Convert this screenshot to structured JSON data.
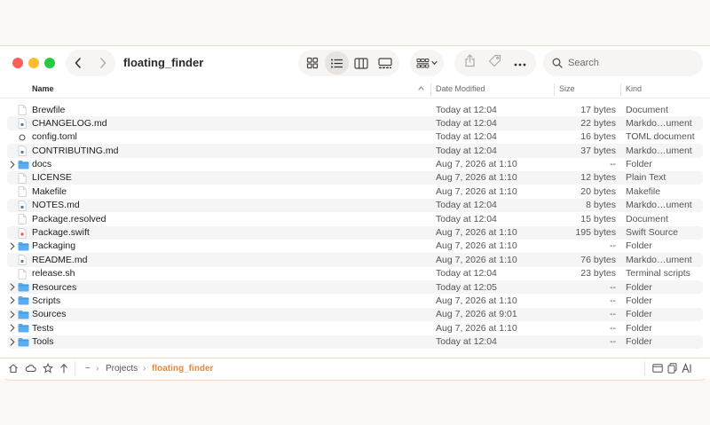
{
  "window": {
    "title": "floating_finder",
    "search_placeholder": "Search"
  },
  "columns": {
    "name": "Name",
    "date": "Date Modified",
    "size": "Size",
    "kind": "Kind"
  },
  "files": [
    {
      "name": "Brewfile",
      "date": "Today at 12:04",
      "size": "17 bytes",
      "kind": "Document",
      "icon": "doc-icon",
      "folder": false
    },
    {
      "name": "CHANGELOG.md",
      "date": "Today at 12:04",
      "size": "22 bytes",
      "kind": "Markdo…ument",
      "icon": "markdown-icon",
      "folder": false
    },
    {
      "name": "config.toml",
      "date": "Today at 12:04",
      "size": "16 bytes",
      "kind": "TOML document",
      "icon": "toml-icon",
      "folder": false
    },
    {
      "name": "CONTRIBUTING.md",
      "date": "Today at 12:04",
      "size": "37 bytes",
      "kind": "Markdo…ument",
      "icon": "markdown-icon",
      "folder": false
    },
    {
      "name": "docs",
      "date": "Aug 7, 2026 at 1:10",
      "size": "--",
      "kind": "Folder",
      "icon": "folder-icon",
      "folder": true
    },
    {
      "name": "LICENSE",
      "date": "Aug 7, 2026 at 1:10",
      "size": "12 bytes",
      "kind": "Plain Text",
      "icon": "doc-icon",
      "folder": false
    },
    {
      "name": "Makefile",
      "date": "Aug 7, 2026 at 1:10",
      "size": "20 bytes",
      "kind": "Makefile",
      "icon": "doc-icon",
      "folder": false
    },
    {
      "name": "NOTES.md",
      "date": "Today at 12:04",
      "size": "8 bytes",
      "kind": "Markdo…ument",
      "icon": "markdown-icon",
      "folder": false
    },
    {
      "name": "Package.resolved",
      "date": "Today at 12:04",
      "size": "15 bytes",
      "kind": "Document",
      "icon": "doc-icon",
      "folder": false
    },
    {
      "name": "Package.swift",
      "date": "Aug 7, 2026 at 1:10",
      "size": "195 bytes",
      "kind": "Swift Source",
      "icon": "swift-icon",
      "folder": false
    },
    {
      "name": "Packaging",
      "date": "Aug 7, 2026 at 1:10",
      "size": "--",
      "kind": "Folder",
      "icon": "folder-icon",
      "folder": true
    },
    {
      "name": "README.md",
      "date": "Aug 7, 2026 at 1:10",
      "size": "76 bytes",
      "kind": "Markdo…ument",
      "icon": "markdown-icon",
      "folder": false
    },
    {
      "name": "release.sh",
      "date": "Today at 12:04",
      "size": "23 bytes",
      "kind": "Terminal scripts",
      "icon": "doc-icon",
      "folder": false
    },
    {
      "name": "Resources",
      "date": "Today at 12:05",
      "size": "--",
      "kind": "Folder",
      "icon": "folder-icon",
      "folder": true
    },
    {
      "name": "Scripts",
      "date": "Aug 7, 2026 at 1:10",
      "size": "--",
      "kind": "Folder",
      "icon": "folder-icon",
      "folder": true
    },
    {
      "name": "Sources",
      "date": "Aug 7, 2026 at 9:01",
      "size": "--",
      "kind": "Folder",
      "icon": "folder-icon",
      "folder": true
    },
    {
      "name": "Tests",
      "date": "Aug 7, 2026 at 1:10",
      "size": "--",
      "kind": "Folder",
      "icon": "folder-icon",
      "folder": true
    },
    {
      "name": "Tools",
      "date": "Today at 12:04",
      "size": "--",
      "kind": "Folder",
      "icon": "folder-icon",
      "folder": true
    }
  ],
  "pathbar": {
    "home": "~",
    "parent": "Projects",
    "current": "floating_finder"
  },
  "colors": {
    "accent": "#e8893a",
    "folder": "#5aaef0",
    "close": "#ff5f57",
    "minimize": "#febc2e",
    "maximize": "#28c840"
  }
}
